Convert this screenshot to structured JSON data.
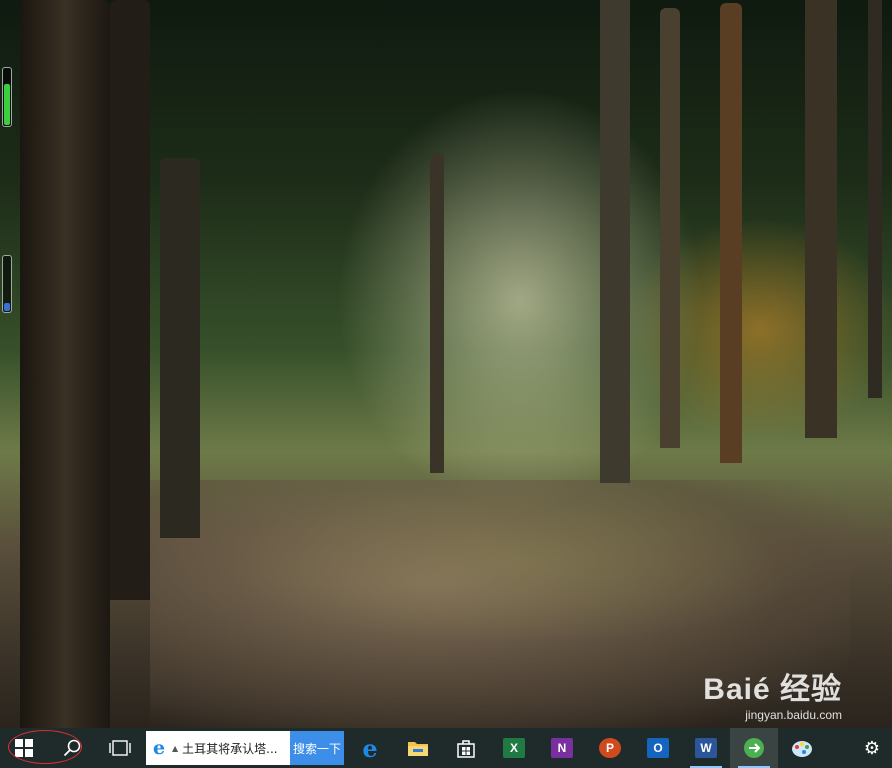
{
  "wallpaper": {
    "description_colors": {
      "canopy": "#1d2c18",
      "sunlight": "#fff8d2",
      "autumn": "#d68c28",
      "path": "#8c785f"
    }
  },
  "watermark": {
    "brand": "Baié 经验",
    "url": "jingyan.baidu.com"
  },
  "taskbar": {
    "start_icon": "windows-logo-icon",
    "search_icon": "search-icon",
    "task_view_icon": "task-view-icon",
    "search_box": {
      "text": "土耳其将承认塔...",
      "button": "搜索一下"
    },
    "apps": [
      {
        "name": "edge",
        "icon": "edge-icon",
        "color": "#1e88e5"
      },
      {
        "name": "file-explorer",
        "icon": "folder-icon",
        "color": "#f2c14e"
      },
      {
        "name": "store",
        "icon": "store-icon",
        "color": "#ffffff"
      },
      {
        "name": "excel",
        "icon": "excel-icon",
        "color": "#1f7a44",
        "letter": "X"
      },
      {
        "name": "onenote",
        "icon": "onenote-icon",
        "color": "#7a2fa0",
        "letter": "N"
      },
      {
        "name": "powerpoint",
        "icon": "powerpoint-icon",
        "color": "#d04a1f",
        "letter": "P"
      },
      {
        "name": "outlook",
        "icon": "outlook-icon",
        "color": "#1565c0",
        "letter": "O"
      },
      {
        "name": "word",
        "icon": "word-icon",
        "color": "#2b579a",
        "letter": "W"
      },
      {
        "name": "green-app",
        "icon": "green-circle-app-icon",
        "color": "#4caf50"
      },
      {
        "name": "paint",
        "icon": "paint-icon",
        "color": "#64b5f6"
      }
    ],
    "settings_icon": "gear-icon"
  },
  "side_meters": [
    {
      "level": 0.7,
      "color": "#3ccf3c"
    },
    {
      "level": 0.15,
      "color": "#3a6fd6"
    }
  ]
}
